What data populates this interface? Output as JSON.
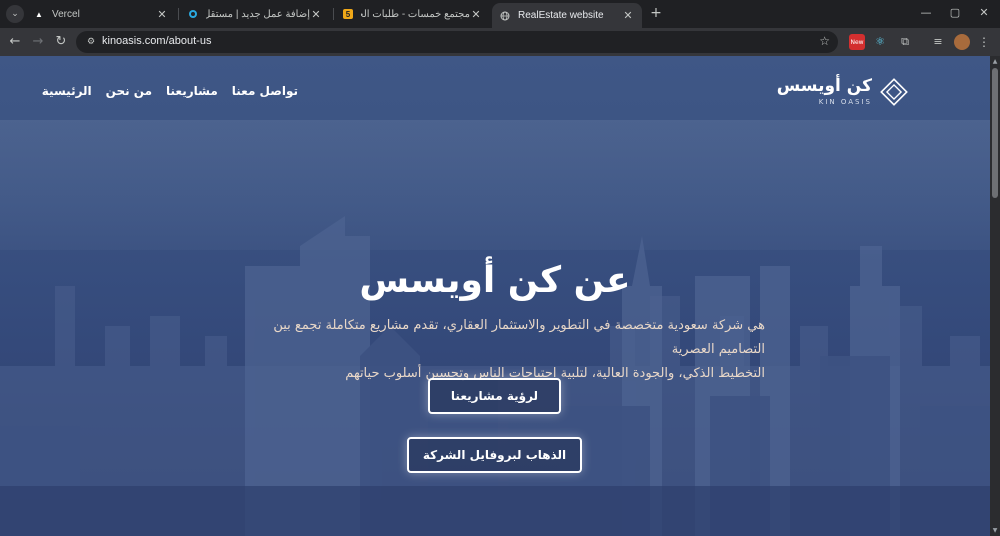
{
  "browser": {
    "tabs": [
      {
        "title": "Vercel",
        "icon": "vercel-icon",
        "active": false
      },
      {
        "title": "إضافة عمل جديد | مستقل",
        "icon": "mostaql-icon",
        "active": false
      },
      {
        "title": "مجتمع خمسات - طلبات الخدمات",
        "icon": "khamsat-icon",
        "active": false
      },
      {
        "title": "RealEstate website",
        "icon": "globe-icon",
        "active": true
      }
    ],
    "new_tab": "+",
    "window": {
      "minimize": "—",
      "maximize": "▢",
      "close": "✕"
    },
    "url": "kinoasis.com/about-us",
    "ext_badge": "New",
    "colors": {
      "frame": "#1f2023",
      "toolbar": "#35363a",
      "omnibox": "#202124"
    }
  },
  "site": {
    "logo": {
      "arabic": "كن أويسس",
      "english": "KIN OASIS"
    },
    "nav": [
      "الرئيسية",
      "من نحن",
      "مشاريعنا",
      "تواصل معنا"
    ],
    "hero": {
      "title": "عن كن أويسس",
      "description_line1": "هي شركة سعودية متخصصة في التطوير والاستثمار العقاري، تقدم مشاريع متكاملة تجمع بين التصاميم العصرية",
      "description_line2": "التخطيط الذكي، والجودة العالية، لتلبية احتياجات الناس وتحسين أسلوب حياتهم",
      "primary_button": "لرؤية مشاريعنا",
      "secondary_button": "الذهاب لبروفايل الشركة"
    },
    "colors": {
      "overlay": "#34497a",
      "description": "#e8d7c8",
      "text": "#ffffff"
    }
  }
}
